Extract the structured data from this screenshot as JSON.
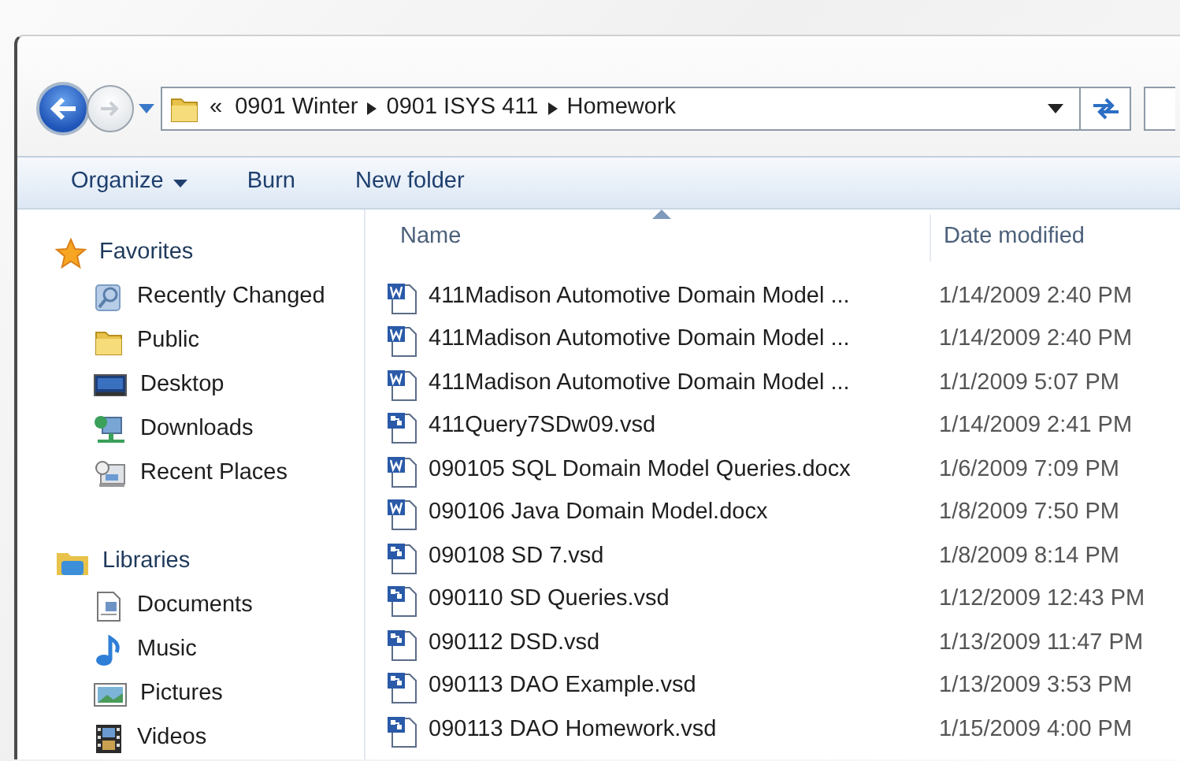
{
  "navigation": {
    "breadcrumb": [
      {
        "label": "«",
        "kind": "overflow"
      },
      {
        "label": "0901 Winter",
        "kind": "folder"
      },
      {
        "label": "0901 ISYS 411",
        "kind": "folder"
      },
      {
        "label": "Homework",
        "kind": "folder"
      }
    ]
  },
  "toolbar": [
    {
      "label": "Organize",
      "has_menu": true
    },
    {
      "label": "Burn",
      "has_menu": false
    },
    {
      "label": "New folder",
      "has_menu": false
    }
  ],
  "sidebar": [
    {
      "label": "Favorites",
      "kind": "star",
      "children": [
        {
          "label": "Recently Changed",
          "kind": "search"
        },
        {
          "label": "Public",
          "kind": "folder"
        },
        {
          "label": "Desktop",
          "kind": "desktop"
        },
        {
          "label": "Downloads",
          "kind": "network"
        },
        {
          "label": "Recent Places",
          "kind": "recent"
        }
      ]
    },
    {
      "label": "Libraries",
      "kind": "library",
      "children": [
        {
          "label": "Documents",
          "kind": "document"
        },
        {
          "label": "Music",
          "kind": "music"
        },
        {
          "label": "Pictures",
          "kind": "picture"
        },
        {
          "label": "Videos",
          "kind": "video"
        }
      ]
    }
  ],
  "columns": [
    {
      "label": "Name",
      "sorted": true
    },
    {
      "label": "Date modified",
      "sorted": false
    }
  ],
  "files": [
    {
      "name": "411Madison Automotive Domain Model ...",
      "kind": "doc",
      "date": "1/14/2009 2:40 PM"
    },
    {
      "name": "411Madison Automotive Domain Model ...",
      "kind": "doc",
      "date": "1/14/2009 2:40 PM"
    },
    {
      "name": "411Madison Automotive Domain Model ...",
      "kind": "doc",
      "date": "1/1/2009 5:07 PM"
    },
    {
      "name": "411Query7SDw09.vsd",
      "kind": "vsd",
      "date": "1/14/2009 2:41 PM"
    },
    {
      "name": "090105 SQL Domain Model Queries.docx",
      "kind": "doc",
      "date": "1/6/2009 7:09 PM"
    },
    {
      "name": "090106 Java Domain Model.docx",
      "kind": "doc",
      "date": "1/8/2009 7:50 PM"
    },
    {
      "name": "090108 SD 7.vsd",
      "kind": "vsd",
      "date": "1/8/2009 8:14 PM"
    },
    {
      "name": "090110 SD Queries.vsd",
      "kind": "vsd",
      "date": "1/12/2009 12:43 PM"
    },
    {
      "name": "090112 DSD.vsd",
      "kind": "vsd",
      "date": "1/13/2009 11:47 PM"
    },
    {
      "name": "090113 DAO Example.vsd",
      "kind": "vsd",
      "date": "1/13/2009 3:53 PM"
    },
    {
      "name": "090113 DAO Homework.vsd",
      "kind": "vsd",
      "date": "1/15/2009 4:00 PM"
    }
  ]
}
